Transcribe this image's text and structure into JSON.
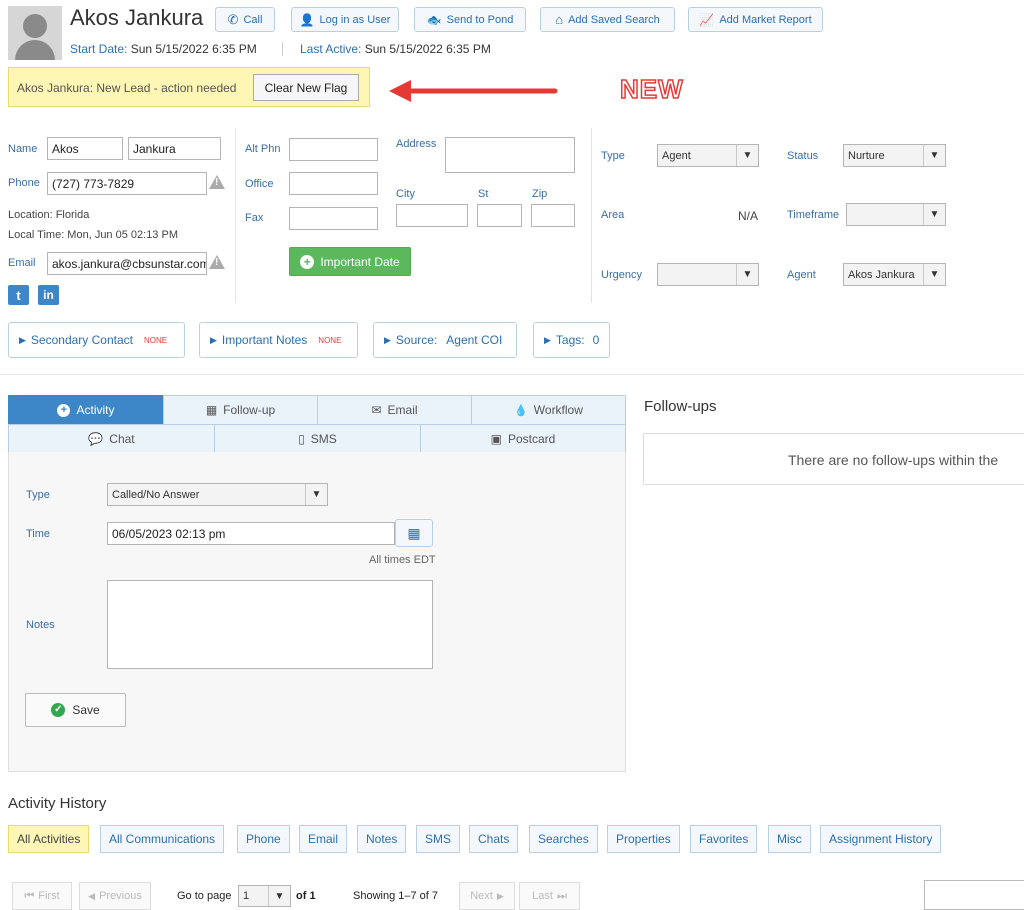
{
  "header": {
    "name": "Akos Jankura",
    "start_date_label": "Start Date:",
    "start_date": "Sun 5/15/2022 6:35 PM",
    "last_active_label": "Last Active:",
    "last_active": "Sun 5/15/2022 6:35 PM",
    "buttons": {
      "call": "Call",
      "login": "Log in as User",
      "pond": "Send to Pond",
      "saved_search": "Add Saved Search",
      "market_report": "Add Market Report"
    }
  },
  "alert": {
    "message": "Akos Jankura: New Lead - action needed",
    "clear_button": "Clear New Flag",
    "annotation": "NEW"
  },
  "contact": {
    "name_label": "Name",
    "first_name": "Akos",
    "last_name": "Jankura",
    "phone_label": "Phone",
    "phone": "(727) 773-7829",
    "location": "Location: Florida",
    "local_time": "Local Time: Mon, Jun 05 02:13 PM",
    "email_label": "Email",
    "email": "akos.jankura@cbsunstar.com",
    "alt_phone_label": "Alt Phn",
    "office_label": "Office",
    "fax_label": "Fax",
    "address_label": "Address",
    "city_label": "City",
    "st_label": "St",
    "zip_label": "Zip",
    "important_date_button": "Important Date"
  },
  "meta": {
    "type_label": "Type",
    "type_value": "Agent",
    "status_label": "Status",
    "status_value": "Nurture",
    "area_label": "Area",
    "area_value": "N/A",
    "timeframe_label": "Timeframe",
    "timeframe_value": "",
    "urgency_label": "Urgency",
    "urgency_value": "",
    "agent_label": "Agent",
    "agent_value": "Akos Jankura"
  },
  "info_pills": {
    "secondary": "Secondary Contact",
    "secondary_tag": "NONE",
    "notes": "Important Notes",
    "notes_tag": "NONE",
    "source_label": "Source:",
    "source_value": "Agent COI",
    "tags_label": "Tags:",
    "tags_value": "0"
  },
  "tabs": {
    "row1": [
      "Activity",
      "Follow-up",
      "Email",
      "Workflow"
    ],
    "row2": [
      "Chat",
      "SMS",
      "Postcard"
    ]
  },
  "activity_form": {
    "type_label": "Type",
    "type_value": "Called/No Answer",
    "time_label": "Time",
    "time_value": "06/05/2023 02:13 pm",
    "timezone_note": "All times EDT",
    "notes_label": "Notes",
    "save_button": "Save"
  },
  "followups": {
    "title": "Follow-ups",
    "empty_text": "There are no follow-ups within the"
  },
  "history": {
    "title": "Activity History",
    "filters": [
      "All Activities",
      "All Communications",
      "Phone",
      "Email",
      "Notes",
      "SMS",
      "Chats",
      "Searches",
      "Properties",
      "Favorites",
      "Misc",
      "Assignment History"
    ]
  },
  "pagination": {
    "first": "First",
    "previous": "Previous",
    "go_to_page": "Go to page",
    "page_value": "1",
    "of_total": "of 1",
    "showing": "Showing 1–7 of 7",
    "next": "Next",
    "last": "Last"
  },
  "colors": {
    "accent": "#3d87c9",
    "alert_bg": "#fdf6b4",
    "green_button": "#5cb85c",
    "annotation": "#e53935"
  }
}
